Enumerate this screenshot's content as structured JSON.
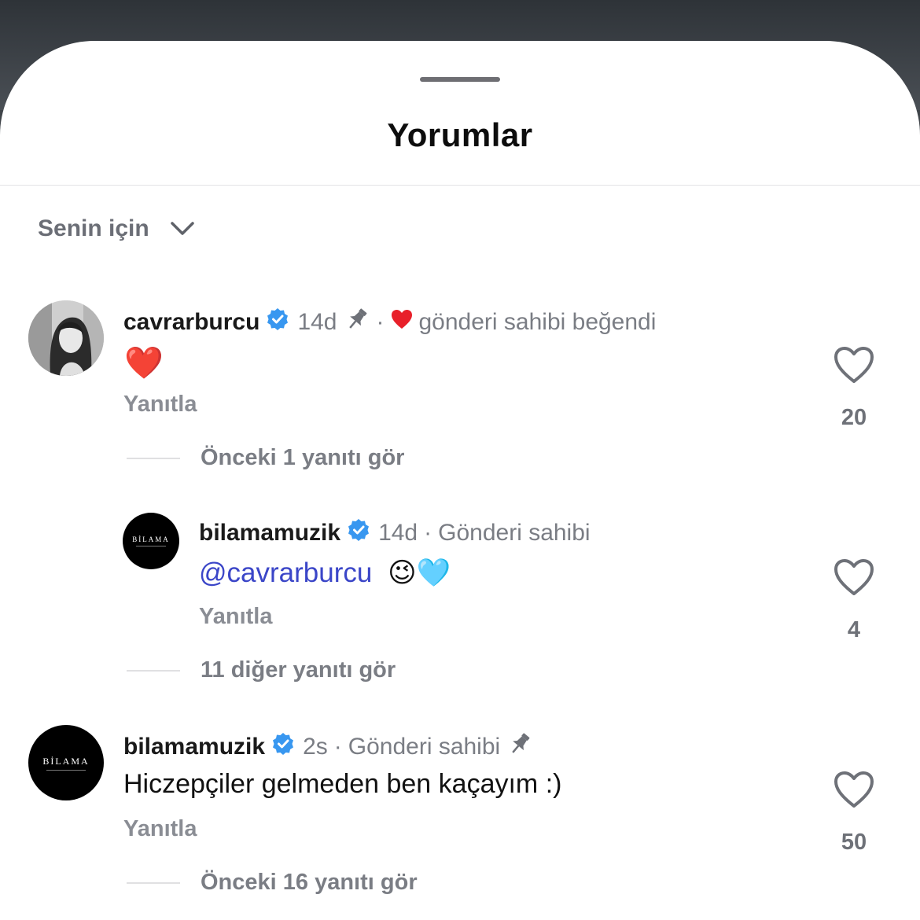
{
  "header": {
    "title": "Yorumlar"
  },
  "sort": {
    "label": "Senin için",
    "icon": "chevron-down-icon"
  },
  "comments": [
    {
      "username": "cavrarburcu",
      "verified": true,
      "time": "14d",
      "pinned": true,
      "separator": "·",
      "creator_liked_text": "gönderi sahibi beğendi",
      "text": "❤️",
      "reply_label": "Yanıtla",
      "likes": "20",
      "more_replies": "Önceki 1 yanıtı gör"
    },
    {
      "username": "bilamamuzik",
      "avatar_text": "BİLAMA",
      "verified": true,
      "time": "14d",
      "separator": "·",
      "creator_label": "Gönderi sahibi",
      "mention": "@cavrarburcu",
      "emojis": "😉🩵",
      "reply_label": "Yanıtla",
      "likes": "4",
      "more_replies": "11 diğer yanıtı gör"
    },
    {
      "username": "bilamamuzik",
      "avatar_text": "BİLAMA",
      "verified": true,
      "time": "2s",
      "separator": "·",
      "creator_label": "Gönderi sahibi",
      "pinned": true,
      "text": "Hiczepçiler gelmeden ben kaçayım :)",
      "reply_label": "Yanıtla",
      "likes": "50",
      "more_replies": "Önceki 16 yanıtı gör"
    }
  ],
  "colors": {
    "mention": "#3b46c8",
    "verified": "#3897f0",
    "heart": "#e8202a",
    "muted_text": "#7a7d84"
  }
}
